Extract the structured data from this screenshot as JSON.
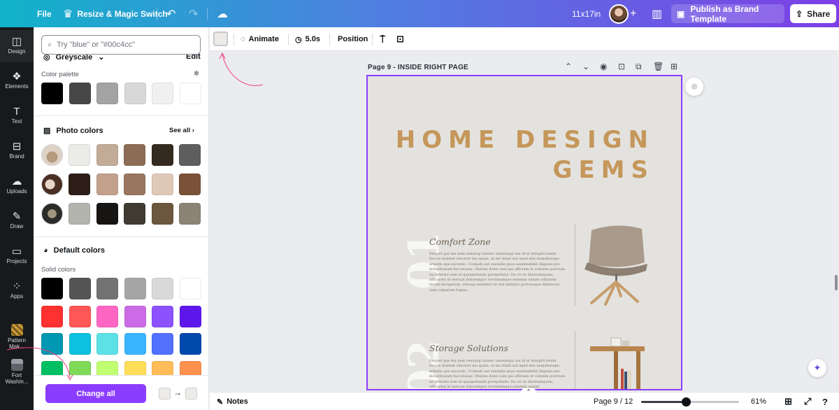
{
  "topbar": {
    "file": "File",
    "resize": "Resize & Magic Switch",
    "size": "11x17in",
    "publish": "Publish as Brand Template",
    "share": "Share"
  },
  "rail": {
    "items": [
      {
        "label": "Design",
        "icon": "design-icon"
      },
      {
        "label": "Elements",
        "icon": "elements-icon"
      },
      {
        "label": "Text",
        "icon": "text-icon"
      },
      {
        "label": "Brand",
        "icon": "brand-icon"
      },
      {
        "label": "Uploads",
        "icon": "uploads-icon"
      },
      {
        "label": "Draw",
        "icon": "draw-icon"
      },
      {
        "label": "Projects",
        "icon": "projects-icon"
      },
      {
        "label": "Apps",
        "icon": "apps-icon"
      },
      {
        "label": "Pattern Mak...",
        "icon": "pattern-maker-icon"
      },
      {
        "label": "Fort Washin...",
        "icon": "fort-washington-icon"
      }
    ]
  },
  "panel": {
    "search_placeholder": "Try \"blue\" or \"#00c4cc\"",
    "palette_name": "Greyscale",
    "edit": "Edit",
    "color_palette_label": "Color palette",
    "palette_colors": [
      "#000000",
      "#474747",
      "#a3a3a3",
      "#d8d8d8",
      "#f0f0f0",
      "#ffffff"
    ],
    "photo_colors_title": "Photo colors",
    "see_all": "See all",
    "photo_rows": [
      [
        "#ebebe7",
        "#c2ac97",
        "#8c6c55",
        "#352a1f",
        "#5e5e5e"
      ],
      [
        "#2d1f18",
        "#c2a08c",
        "#9a7660",
        "#e0c8b9",
        "#7a5238"
      ],
      [
        "#b4b4ae",
        "#161513",
        "#3f3b33",
        "#6b563e",
        "#8b8476"
      ]
    ],
    "default_colors_title": "Default colors",
    "solid_colors_label": "Solid colors",
    "solid_rows": [
      [
        "#000000",
        "#545454",
        "#737373",
        "#a6a6a6",
        "#d9d9d9",
        "#ffffff"
      ],
      [
        "#ff3131",
        "#ff5757",
        "#ff66c4",
        "#cb6ce6",
        "#8c52ff",
        "#5e17eb"
      ],
      [
        "#0097b2",
        "#0cc0df",
        "#5ce1e6",
        "#38b6ff",
        "#5271ff",
        "#004aad"
      ],
      [
        "#00bf63",
        "#7ed957",
        "#c1ff72",
        "#ffde59",
        "#ffbd59",
        "#ff914d"
      ]
    ],
    "change_all": "Change all"
  },
  "context_toolbar": {
    "animate": "Animate",
    "duration": "5.0s",
    "position": "Position"
  },
  "page_header": {
    "label": "Page 9 - INSIDE RIGHT PAGE"
  },
  "canvas": {
    "headline_line1": "HOME DESIGN",
    "headline_line2": "GEMS",
    "number_1": "01",
    "number_2": "02",
    "section1_title": "Comfort Zone",
    "section1_body": "Eerped que ma nam remolup tatatec umenisqui aut id et doluptti tenim foccus mullent sincerer mo quam, ut mo blant aut eped min nequibusape erbedis que excestio. Ucimedi aut exaindis quos sundendebit illigenis pro doluptbusam faccatusae. Otatem doles sum qui officium et volenim porroum ea referate sum et quaspedanda porepellabo. Ita vic te destrumquam, officarest id eseruat dolorempor torvimumque eatemm uniunt oditatem ilictim facepetum, vitecep eonsifect id suit millatur porrosoque ditiaturas sum culparum fugiae.",
    "section2_title": "Storage Solutions",
    "section2_body": "Eerped que ma nam remolup tatatec umenisqui aut id et doluptti tenim foccus mullent sincerer mo quam, ut mo blant aut eped min nequibusape erbedis que excestio. Ucimedi aut exaindis quos sundendebit illigenis pro doluptbusam faccatusae. Otatem doles sum qui officium et volenim porroum ea referate sum et quaspedanda porepellabo. Ita vic te destrumquam, officarest id eseruat dolorempor torvimumque eatemm uniunt"
  },
  "footer": {
    "notes": "Notes",
    "page_counter": "Page 9 / 12",
    "zoom": "61%",
    "zoom_level": 0.46
  }
}
